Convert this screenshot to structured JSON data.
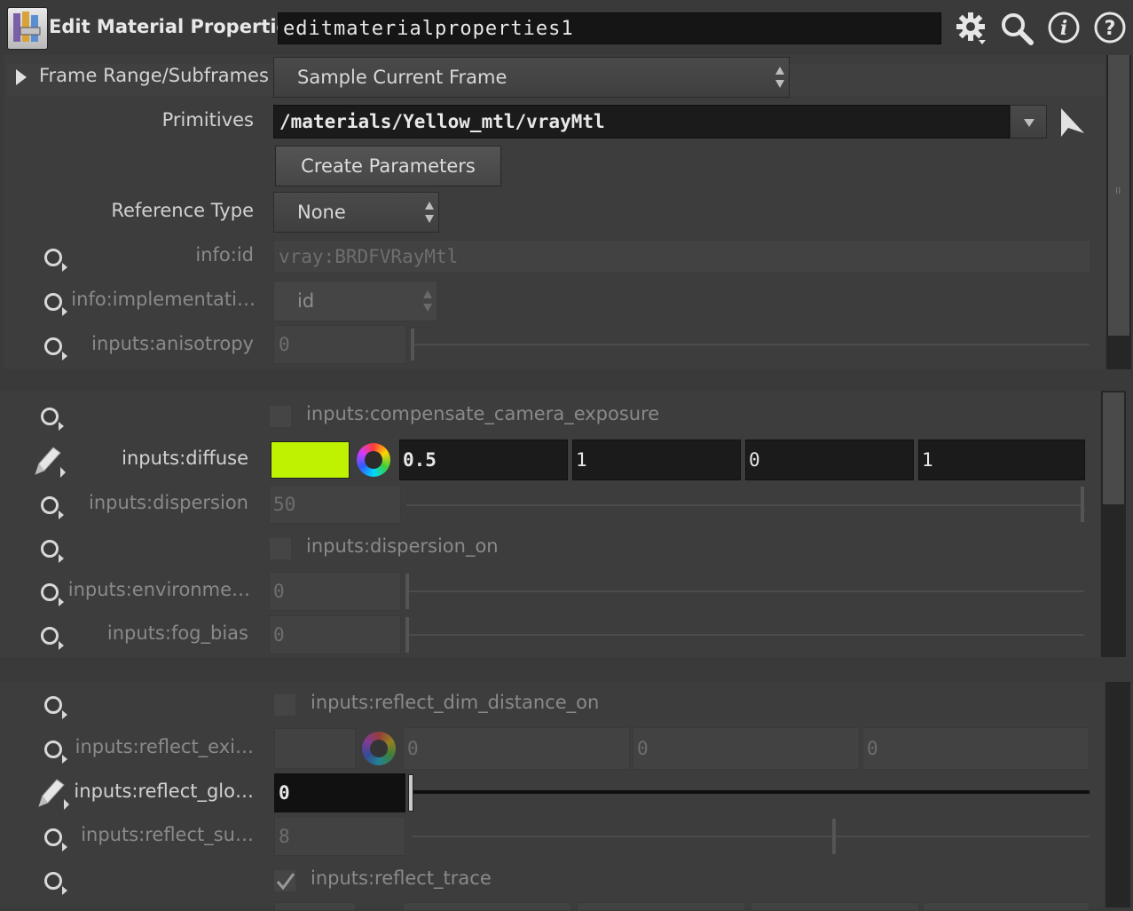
{
  "header": {
    "title": "Edit Material Properties",
    "node_name": "editmaterialproperties1",
    "icons": [
      "node-icon",
      "gear-icon",
      "search-icon",
      "info-icon",
      "help-icon"
    ]
  },
  "frame_range": {
    "label": "Frame Range/Subframes",
    "value": "Sample Current Frame"
  },
  "primitives": {
    "label": "Primitives",
    "value": "/materials/Yellow_mtl/vrayMtl"
  },
  "create_parameters": {
    "label": "Create Parameters"
  },
  "reference_type": {
    "label": "Reference Type",
    "value": "None"
  },
  "info_id": {
    "label": "info:id",
    "value": "vray:BRDFVRayMtl"
  },
  "info_impl": {
    "label": "info:implementati…",
    "value": "id"
  },
  "anisotropy": {
    "label": "inputs:anisotropy",
    "value": "0"
  },
  "compensate": {
    "label": "inputs:compensate_camera_exposure"
  },
  "diffuse": {
    "label": "inputs:diffuse",
    "swatch_color": "#bff200",
    "values": [
      "0.5",
      "1",
      "0",
      "1"
    ]
  },
  "dispersion": {
    "label": "inputs:dispersion",
    "value": "50"
  },
  "dispersion_on": {
    "label": "inputs:dispersion_on"
  },
  "environment": {
    "label": "inputs:environme…",
    "value": "0"
  },
  "fog_bias": {
    "label": "inputs:fog_bias",
    "value": "0"
  },
  "reflect_dim_on": {
    "label": "inputs:reflect_dim_distance_on"
  },
  "reflect_exit": {
    "label": "inputs:reflect_exi…",
    "values": [
      "0",
      "0",
      "0"
    ]
  },
  "reflect_glossiness": {
    "label": "inputs:reflect_glo…",
    "value": "0"
  },
  "reflect_subdivs": {
    "label": "inputs:reflect_su…",
    "value": "8",
    "slider_fraction": 0.62
  },
  "reflect_trace": {
    "label": "inputs:reflect_trace",
    "checked": true
  },
  "colors": {
    "accent_swatch": "#bff200",
    "background": "#3a3a3a",
    "field": "#1b1b1b"
  }
}
